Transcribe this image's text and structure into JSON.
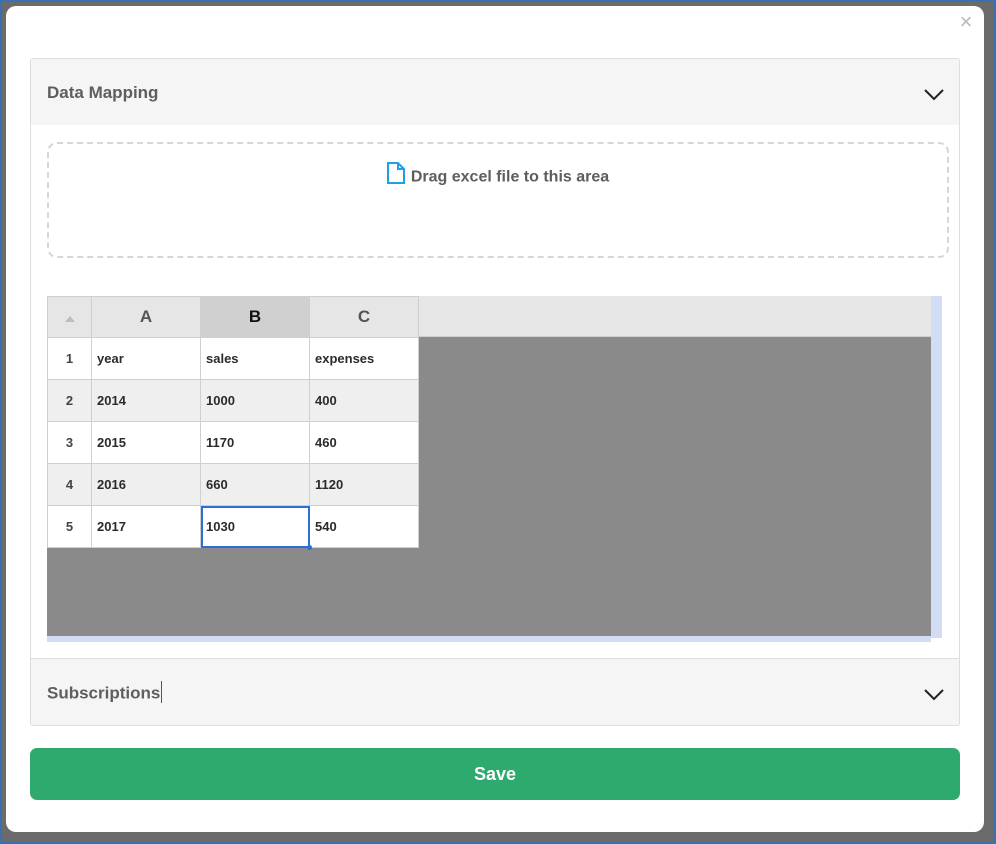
{
  "modal": {
    "close_label": "×"
  },
  "data_mapping": {
    "title": "Data Mapping",
    "dropzone_text": "Drag excel file to this area",
    "column_headers": [
      "A",
      "B",
      "C"
    ],
    "selected_column": "B",
    "rows": [
      {
        "num": "1",
        "cells": [
          "year",
          "sales",
          "expenses"
        ]
      },
      {
        "num": "2",
        "cells": [
          "2014",
          "1000",
          "400"
        ]
      },
      {
        "num": "3",
        "cells": [
          "2015",
          "1170",
          "460"
        ]
      },
      {
        "num": "4",
        "cells": [
          "2016",
          "660",
          "1120"
        ]
      },
      {
        "num": "5",
        "cells": [
          "2017",
          "1030",
          "540"
        ]
      }
    ],
    "selected_cell": "B5"
  },
  "subscriptions": {
    "title": "Subscriptions"
  },
  "save_button": {
    "label": "Save"
  },
  "colors": {
    "save_button": "#2eaa6f",
    "selection": "#2b6fd6",
    "file_icon": "#1ea0e8"
  },
  "icons": {
    "close": "close-icon",
    "chevron": "chevron-down-icon",
    "file": "file-icon"
  }
}
